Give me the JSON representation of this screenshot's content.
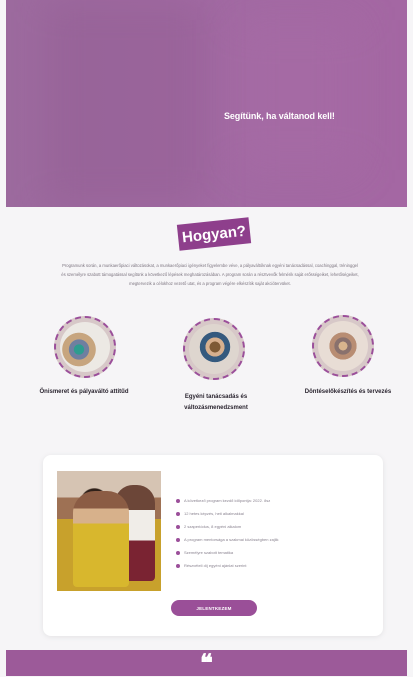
{
  "hero": {
    "text": "Segítünk, ha váltanod kell!"
  },
  "main": {
    "title": "Hogyan?",
    "intro": "Programunk során, a munkaerőpiaci változásokat, a munkaerőpiaci igényeket figyelembe véve, a pályaváltóknak egyéni tanácsadással, coachinggal, tréninggel és személyre szabott támogatással segítünk a következő lépések meghatározásában. A program során a résztvevők felmérik saját erősségeiket, lehetőségeiket, megtervezik a célokhoz vezető utat, és a program végére elkészítik saját akciótervüket."
  },
  "steps": [
    {
      "caption": "Önismeret és pályaváltó attitűd"
    },
    {
      "caption": "Egyéni tanácsadás és változásmenedzsment"
    },
    {
      "caption": "Döntéselőkészítés és tervezés"
    }
  ],
  "card": {
    "features": [
      "A következő program kezdő időpontja: 2022. ősz",
      "12 hetes képzés, heti alkalmakkal",
      "2 szaperiódus, 8 egyéni alkalom",
      "A program mentorsága a szakmai közösségben zajlik",
      "Személyre szabott tematika",
      "Részvételi díj egyéni ajánlat szerint"
    ],
    "cta": "JELENTKEZEM"
  },
  "footer": {
    "quote_mark": "❝"
  }
}
